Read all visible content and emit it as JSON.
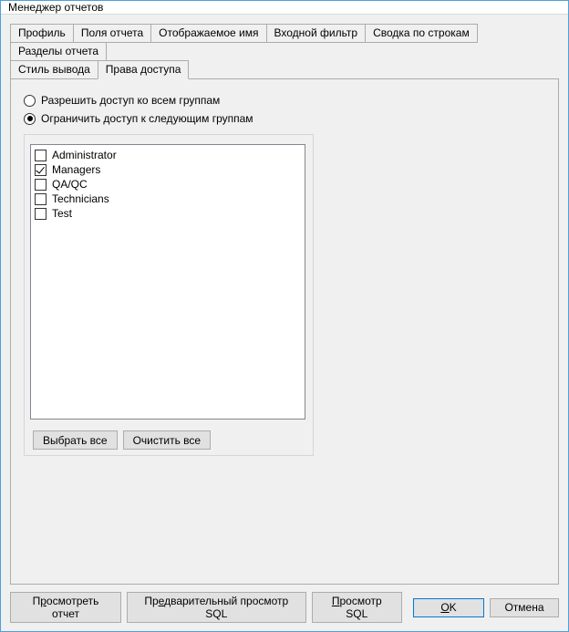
{
  "window": {
    "title": "Менеджер отчетов"
  },
  "tabs": {
    "row1": [
      {
        "label": "Профиль"
      },
      {
        "label": "Поля отчета"
      },
      {
        "label": "Отображаемое имя"
      },
      {
        "label": "Входной фильтр"
      },
      {
        "label": "Сводка по строкам"
      },
      {
        "label": "Разделы отчета"
      }
    ],
    "row2": [
      {
        "label": "Стиль вывода"
      },
      {
        "label": "Права доступа",
        "active": true
      }
    ]
  },
  "access": {
    "radio_all": "Разрешить доступ ко всем группам",
    "radio_limit": "Ограничить доступ к следующим группам",
    "selected": "limit",
    "groups": [
      {
        "name": "Administrator",
        "checked": false
      },
      {
        "name": "Managers",
        "checked": true
      },
      {
        "name": "QA/QC",
        "checked": false
      },
      {
        "name": "Technicians",
        "checked": false
      },
      {
        "name": "Test",
        "checked": false
      }
    ],
    "select_all": "Выбрать все",
    "clear_all": "Очистить все"
  },
  "footer": {
    "view_report_pre": "П",
    "view_report_u": "р",
    "view_report_post": "осмотреть отчет",
    "preview_sql_pre": "Пр",
    "preview_sql_u": "е",
    "preview_sql_post": "дварительный просмотр SQL",
    "view_sql_pre": "",
    "view_sql_u": "П",
    "view_sql_post": "росмотр SQL",
    "ok_pre": "",
    "ok_u": "O",
    "ok_post": "K",
    "cancel": "Отмена"
  }
}
